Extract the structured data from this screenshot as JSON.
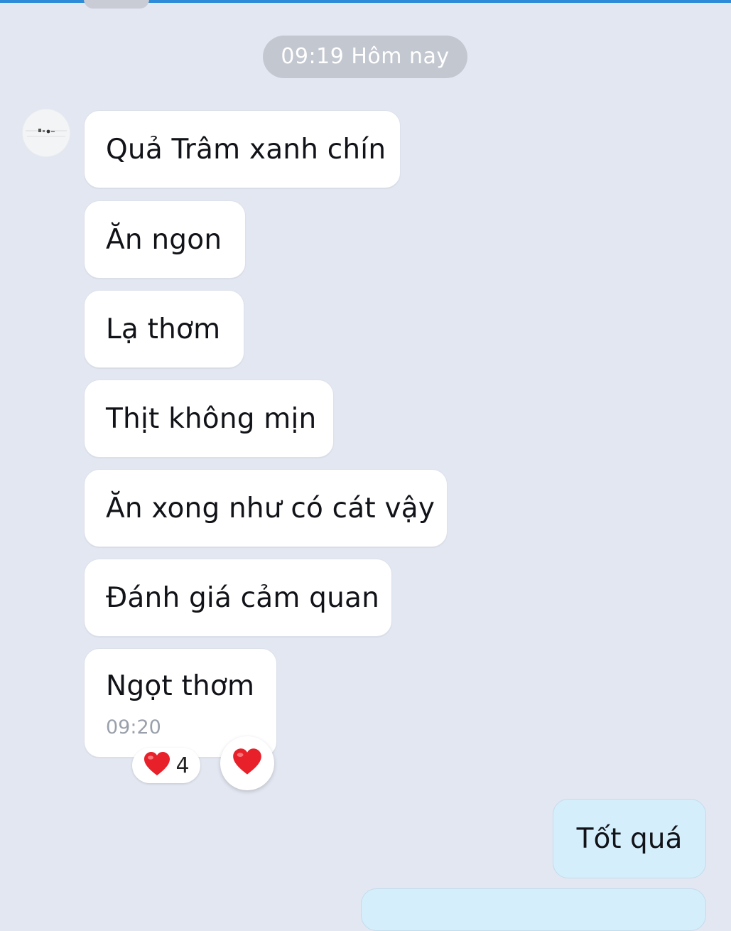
{
  "chat": {
    "date_separator": "09:19 Hôm nay",
    "incoming": [
      {
        "text": "Quả Trâm xanh chín"
      },
      {
        "text": "Ăn ngon"
      },
      {
        "text": "Lạ thơm"
      },
      {
        "text": "Thịt không mịn"
      },
      {
        "text": "Ăn xong như có cát vậy"
      },
      {
        "text": "Đánh giá cảm quan"
      },
      {
        "text": "Ngọt thơm",
        "time": "09:20"
      }
    ],
    "reaction": {
      "icon": "heart-icon",
      "count": "4",
      "color": "#e8202a"
    },
    "outgoing": [
      {
        "text": "Tốt quá"
      }
    ]
  },
  "theme": {
    "background": "#e3e7f1",
    "incoming_bubble": "#ffffff",
    "outgoing_bubble": "#d5eefc",
    "accent": "#2e8bd8"
  }
}
